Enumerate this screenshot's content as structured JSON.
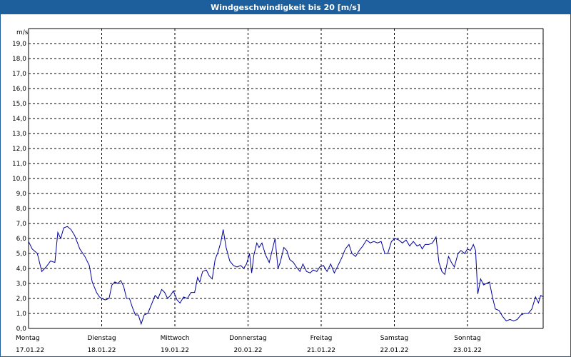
{
  "header": {
    "title": "Windgeschwindigkeit bis 20 [m/s]"
  },
  "chart_data": {
    "type": "line",
    "title": "Windgeschwindigkeit bis 20 [m/s]",
    "ylabel": "m/s",
    "xlabel": "",
    "ylim": [
      0,
      20
    ],
    "y_ticks": [
      "0,0",
      "1,0",
      "2,0",
      "3,0",
      "4,0",
      "5,0",
      "6,0",
      "7,0",
      "8,0",
      "9,0",
      "10,0",
      "11,0",
      "12,0",
      "13,0",
      "14,0",
      "15,0",
      "16,0",
      "17,0",
      "18,0",
      "19,0"
    ],
    "x_days": [
      {
        "day": "Montag",
        "date": "17.01.22"
      },
      {
        "day": "Dienstag",
        "date": "18.01.22"
      },
      {
        "day": "Mittwoch",
        "date": "19.01.22"
      },
      {
        "day": "Donnerstag",
        "date": "20.01.22"
      },
      {
        "day": "Freitag",
        "date": "21.01.22"
      },
      {
        "day": "Samstag",
        "date": "22.01.22"
      },
      {
        "day": "Sonntag",
        "date": "23.01.22"
      }
    ],
    "grid": true,
    "series_color": "#0000a0",
    "series": [
      {
        "values": [
          [
            0.0,
            5.8
          ],
          [
            0.05,
            5.3
          ],
          [
            0.12,
            5.0
          ],
          [
            0.18,
            3.8
          ],
          [
            0.24,
            4.1
          ],
          [
            0.3,
            4.5
          ],
          [
            0.36,
            4.4
          ],
          [
            0.4,
            6.4
          ],
          [
            0.44,
            6.0
          ],
          [
            0.48,
            6.7
          ],
          [
            0.53,
            6.8
          ],
          [
            0.58,
            6.6
          ],
          [
            0.63,
            6.2
          ],
          [
            0.7,
            5.3
          ],
          [
            0.77,
            4.8
          ],
          [
            0.83,
            4.2
          ],
          [
            0.87,
            3.1
          ],
          [
            0.93,
            2.4
          ],
          [
            0.97,
            2.1
          ],
          [
            1.0,
            2.0
          ],
          [
            1.05,
            1.9
          ],
          [
            1.1,
            2.0
          ],
          [
            1.14,
            2.9
          ],
          [
            1.18,
            3.1
          ],
          [
            1.22,
            3.0
          ],
          [
            1.26,
            3.2
          ],
          [
            1.3,
            2.8
          ],
          [
            1.34,
            2.0
          ],
          [
            1.38,
            2.0
          ],
          [
            1.42,
            1.4
          ],
          [
            1.46,
            0.9
          ],
          [
            1.5,
            0.9
          ],
          [
            1.54,
            0.3
          ],
          [
            1.58,
            0.9
          ],
          [
            1.63,
            1.0
          ],
          [
            1.68,
            1.6
          ],
          [
            1.73,
            2.2
          ],
          [
            1.77,
            2.0
          ],
          [
            1.82,
            2.6
          ],
          [
            1.86,
            2.4
          ],
          [
            1.9,
            2.0
          ],
          [
            1.94,
            2.2
          ],
          [
            1.98,
            2.5
          ],
          [
            2.03,
            1.9
          ],
          [
            2.07,
            1.7
          ],
          [
            2.12,
            2.1
          ],
          [
            2.17,
            2.0
          ],
          [
            2.22,
            2.4
          ],
          [
            2.27,
            2.4
          ],
          [
            2.31,
            3.4
          ],
          [
            2.34,
            3.1
          ],
          [
            2.38,
            3.8
          ],
          [
            2.43,
            3.9
          ],
          [
            2.47,
            3.5
          ],
          [
            2.51,
            3.3
          ],
          [
            2.55,
            4.6
          ],
          [
            2.59,
            5.1
          ],
          [
            2.63,
            5.8
          ],
          [
            2.66,
            6.6
          ],
          [
            2.7,
            5.4
          ],
          [
            2.75,
            4.5
          ],
          [
            2.8,
            4.2
          ],
          [
            2.85,
            4.1
          ],
          [
            2.9,
            4.2
          ],
          [
            2.94,
            4.0
          ],
          [
            2.98,
            4.3
          ],
          [
            3.02,
            5.0
          ],
          [
            3.05,
            3.7
          ],
          [
            3.08,
            4.9
          ],
          [
            3.12,
            5.7
          ],
          [
            3.15,
            5.4
          ],
          [
            3.19,
            5.7
          ],
          [
            3.24,
            4.9
          ],
          [
            3.29,
            4.4
          ],
          [
            3.33,
            5.2
          ],
          [
            3.37,
            6.0
          ],
          [
            3.41,
            4.0
          ],
          [
            3.44,
            4.4
          ],
          [
            3.49,
            5.4
          ],
          [
            3.53,
            5.2
          ],
          [
            3.57,
            4.6
          ],
          [
            3.62,
            4.4
          ],
          [
            3.66,
            4.1
          ],
          [
            3.71,
            3.8
          ],
          [
            3.75,
            4.3
          ],
          [
            3.8,
            3.8
          ],
          [
            3.85,
            3.7
          ],
          [
            3.89,
            3.9
          ],
          [
            3.94,
            3.8
          ],
          [
            3.98,
            4.1
          ],
          [
            4.03,
            4.2
          ],
          [
            4.08,
            3.8
          ],
          [
            4.13,
            4.3
          ],
          [
            4.18,
            3.7
          ],
          [
            4.23,
            4.2
          ],
          [
            4.28,
            4.7
          ],
          [
            4.33,
            5.3
          ],
          [
            4.38,
            5.6
          ],
          [
            4.42,
            5.0
          ],
          [
            4.47,
            4.8
          ],
          [
            4.52,
            5.2
          ],
          [
            4.57,
            5.5
          ],
          [
            4.62,
            5.9
          ],
          [
            4.67,
            5.7
          ],
          [
            4.72,
            5.8
          ],
          [
            4.77,
            5.7
          ],
          [
            4.82,
            5.8
          ],
          [
            4.87,
            5.0
          ],
          [
            4.91,
            5.0
          ],
          [
            4.96,
            5.8
          ],
          [
            5.01,
            6.0
          ],
          [
            5.06,
            5.9
          ],
          [
            5.11,
            5.7
          ],
          [
            5.16,
            5.9
          ],
          [
            5.21,
            5.5
          ],
          [
            5.26,
            5.8
          ],
          [
            5.31,
            5.5
          ],
          [
            5.35,
            5.6
          ],
          [
            5.38,
            5.3
          ],
          [
            5.42,
            5.6
          ],
          [
            5.47,
            5.6
          ],
          [
            5.52,
            5.7
          ],
          [
            5.57,
            6.1
          ],
          [
            5.61,
            4.4
          ],
          [
            5.65,
            3.8
          ],
          [
            5.69,
            3.6
          ],
          [
            5.74,
            4.8
          ],
          [
            5.78,
            4.4
          ],
          [
            5.82,
            4.1
          ],
          [
            5.87,
            5.0
          ],
          [
            5.91,
            5.2
          ],
          [
            5.96,
            5.0
          ],
          [
            6.0,
            5.3
          ],
          [
            6.04,
            5.2
          ],
          [
            6.08,
            5.6
          ],
          [
            6.11,
            5.2
          ],
          [
            6.14,
            2.3
          ],
          [
            6.18,
            3.3
          ],
          [
            6.22,
            2.9
          ],
          [
            6.26,
            3.0
          ],
          [
            6.3,
            3.1
          ],
          [
            6.34,
            2.1
          ],
          [
            6.38,
            1.3
          ],
          [
            6.43,
            1.2
          ],
          [
            6.48,
            0.8
          ],
          [
            6.53,
            0.5
          ],
          [
            6.58,
            0.6
          ],
          [
            6.63,
            0.5
          ],
          [
            6.68,
            0.6
          ],
          [
            6.73,
            0.9
          ],
          [
            6.78,
            1.0
          ],
          [
            6.83,
            1.0
          ],
          [
            6.88,
            1.3
          ],
          [
            6.93,
            2.1
          ],
          [
            6.97,
            1.7
          ],
          [
            7.0,
            2.2
          ],
          [
            7.04,
            2.1
          ]
        ]
      }
    ]
  }
}
